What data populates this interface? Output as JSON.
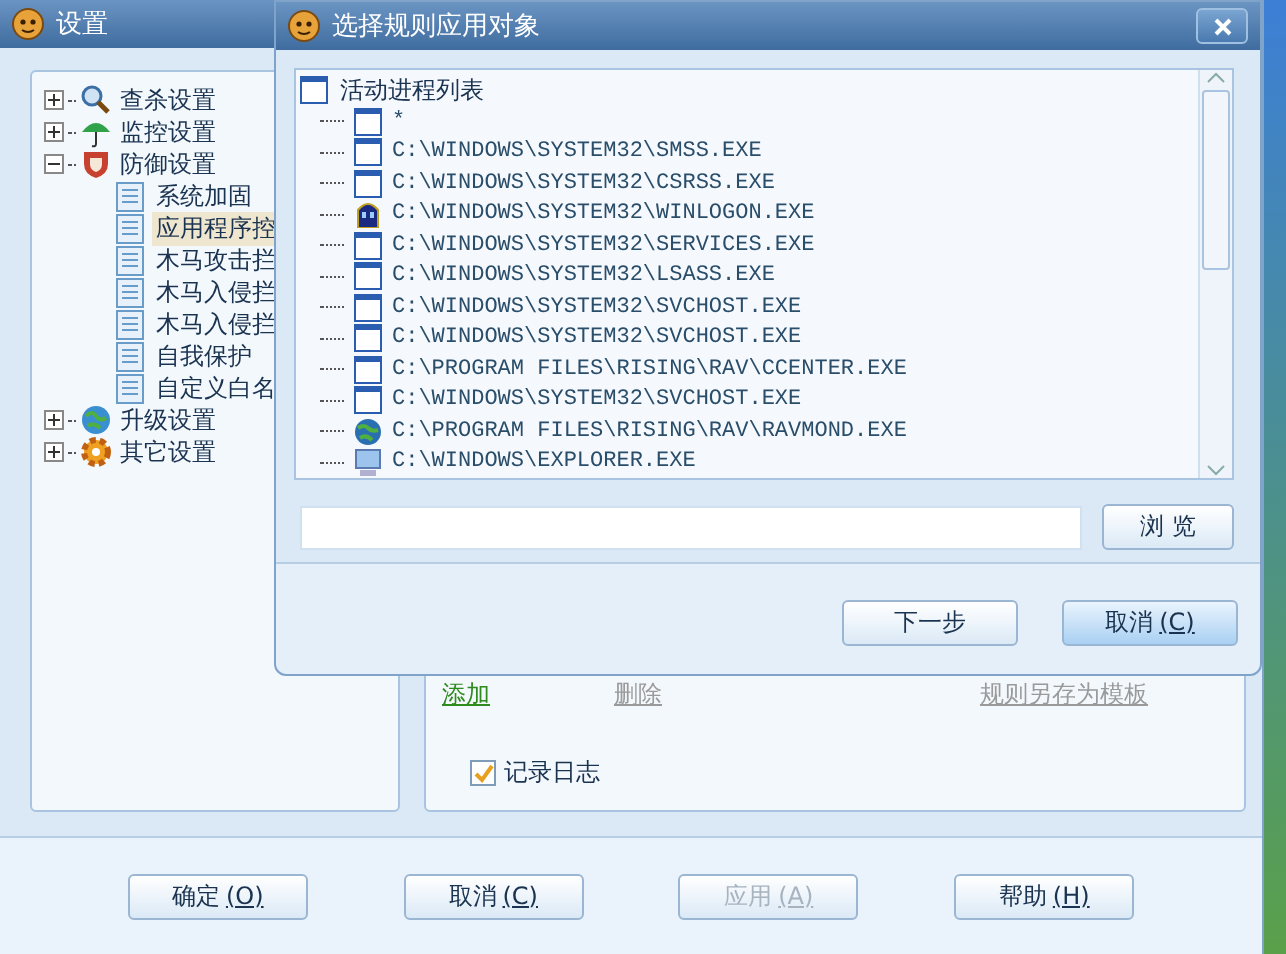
{
  "main_window": {
    "title": "设置",
    "tree": [
      {
        "label": "查杀设置",
        "kind": "scan",
        "expanded": false
      },
      {
        "label": "监控设置",
        "kind": "monitor",
        "expanded": false
      },
      {
        "label": "防御设置",
        "kind": "defense",
        "expanded": true,
        "children": [
          {
            "label": "系统加固",
            "selected": false
          },
          {
            "label": "应用程序控",
            "selected": true
          },
          {
            "label": "木马攻击拦",
            "selected": false
          },
          {
            "label": "木马入侵拦",
            "selected": false
          },
          {
            "label": "木马入侵拦",
            "selected": false
          },
          {
            "label": "自我保护",
            "selected": false
          },
          {
            "label": "自定义白名",
            "selected": false
          }
        ]
      },
      {
        "label": "升级设置",
        "kind": "upgrade",
        "expanded": false
      },
      {
        "label": "其它设置",
        "kind": "other",
        "expanded": false
      }
    ],
    "links": [
      {
        "label": "添加",
        "disabled": false
      },
      {
        "label": "删除",
        "disabled": true
      },
      {
        "label": "规则另存为模板",
        "disabled": true
      }
    ],
    "log_checkbox": {
      "label": "记录日志",
      "checked": true
    },
    "buttons": [
      {
        "label": "确定",
        "key": "(O)",
        "disabled": false
      },
      {
        "label": "取消",
        "key": "(C)",
        "disabled": false
      },
      {
        "label": "应用",
        "key": "(A)",
        "disabled": true
      },
      {
        "label": "帮助",
        "key": "(H)",
        "disabled": false
      }
    ]
  },
  "dialog": {
    "title": "选择规则应用对象",
    "process_list": {
      "label": "活动进程列表",
      "items": [
        {
          "path": "*",
          "kind": "window"
        },
        {
          "path": "C:\\WINDOWS\\SYSTEM32\\SMSS.EXE",
          "kind": "window"
        },
        {
          "path": "C:\\WINDOWS\\SYSTEM32\\CSRSS.EXE",
          "kind": "window"
        },
        {
          "path": "C:\\WINDOWS\\SYSTEM32\\WINLOGON.EXE",
          "kind": "logon"
        },
        {
          "path": "C:\\WINDOWS\\SYSTEM32\\SERVICES.EXE",
          "kind": "window"
        },
        {
          "path": "C:\\WINDOWS\\SYSTEM32\\LSASS.EXE",
          "kind": "window"
        },
        {
          "path": "C:\\WINDOWS\\SYSTEM32\\SVCHOST.EXE",
          "kind": "window"
        },
        {
          "path": "C:\\WINDOWS\\SYSTEM32\\SVCHOST.EXE",
          "kind": "window"
        },
        {
          "path": "C:\\PROGRAM FILES\\RISING\\RAV\\CCENTER.EXE",
          "kind": "window"
        },
        {
          "path": "C:\\WINDOWS\\SYSTEM32\\SVCHOST.EXE",
          "kind": "window"
        },
        {
          "path": "C:\\PROGRAM FILES\\RISING\\RAV\\RAVMOND.EXE",
          "kind": "service"
        },
        {
          "path": "C:\\WINDOWS\\EXPLORER.EXE",
          "kind": "shell"
        }
      ]
    },
    "browse_button": "浏 览",
    "buttons": [
      {
        "label": "下一步",
        "focused": false
      },
      {
        "label": "取消",
        "key": "(C)",
        "focused": true
      }
    ]
  }
}
